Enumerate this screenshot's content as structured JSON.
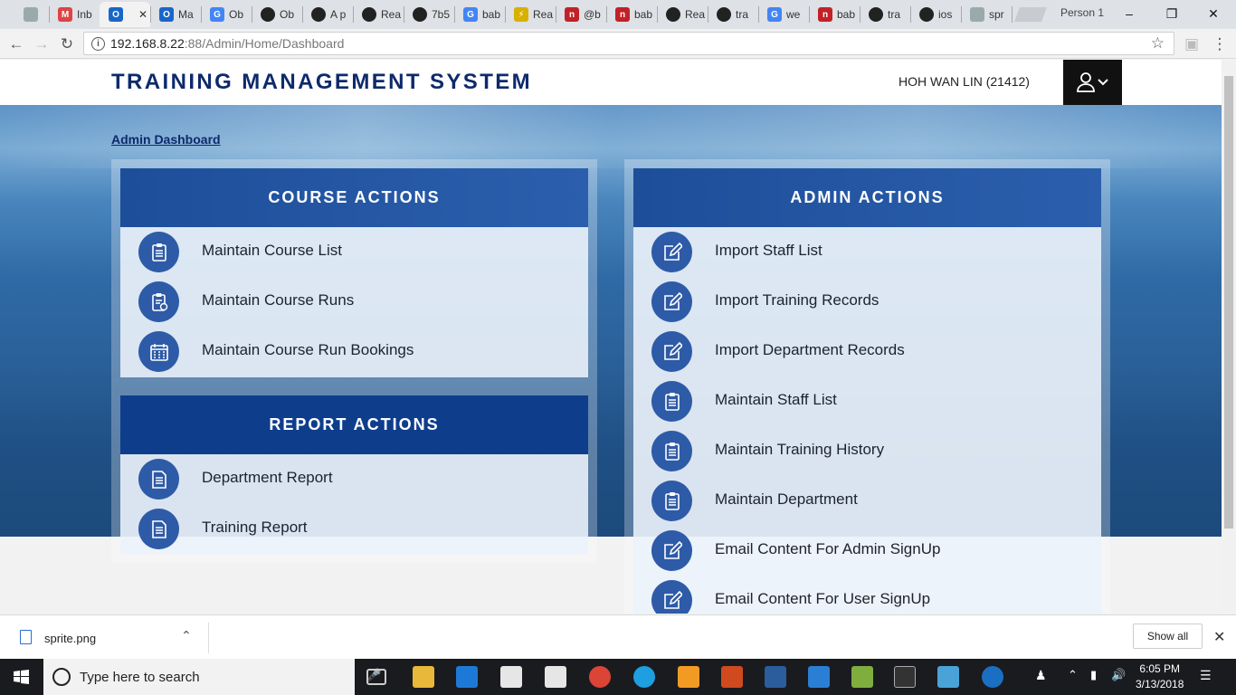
{
  "browser": {
    "tabs": [
      {
        "label": "",
        "icon": "page-icon"
      },
      {
        "label": "Inb",
        "icon": "gmail-icon"
      },
      {
        "label": "",
        "icon": "app-icon"
      },
      {
        "label": "Ma",
        "icon": "app-icon"
      },
      {
        "label": "Ob",
        "icon": "google-icon"
      },
      {
        "label": "Ob",
        "icon": "github-icon"
      },
      {
        "label": "A p",
        "icon": "github-icon"
      },
      {
        "label": "Rea",
        "icon": "github-icon"
      },
      {
        "label": "7b5",
        "icon": "github-icon"
      },
      {
        "label": "bab",
        "icon": "google-icon"
      },
      {
        "label": "Rea",
        "icon": "bolt-icon"
      },
      {
        "label": "@b",
        "icon": "npm-icon"
      },
      {
        "label": "bab",
        "icon": "npm-icon"
      },
      {
        "label": "Rea",
        "icon": "github-icon"
      },
      {
        "label": "tra",
        "icon": "github-icon"
      },
      {
        "label": "we",
        "icon": "google-icon"
      },
      {
        "label": "bab",
        "icon": "npm-icon"
      },
      {
        "label": "tra",
        "icon": "github-icon"
      },
      {
        "label": "ios",
        "icon": "github-icon"
      },
      {
        "label": "spr",
        "icon": "page-icon"
      }
    ],
    "profile": "Person 1",
    "url_host": "192.168.8.22",
    "url_path": ":88/Admin/Home/Dashboard"
  },
  "app": {
    "title": "TRAINING MANAGEMENT SYSTEM",
    "user": "HOH WAN LIN (21412)",
    "breadcrumb": "Admin Dashboard"
  },
  "panels": {
    "course": {
      "title": "COURSE ACTIONS",
      "items": [
        {
          "label": "Maintain Course List",
          "icon": "clipboard-icon"
        },
        {
          "label": "Maintain Course Runs",
          "icon": "clipboard-check-icon"
        },
        {
          "label": "Maintain Course Run Bookings",
          "icon": "calendar-icon"
        }
      ]
    },
    "report": {
      "title": "REPORT ACTIONS",
      "items": [
        {
          "label": "Department Report",
          "icon": "document-icon"
        },
        {
          "label": "Training Report",
          "icon": "document-icon"
        }
      ]
    },
    "admin": {
      "title": "ADMIN ACTIONS",
      "items": [
        {
          "label": "Import Staff List",
          "icon": "edit-icon"
        },
        {
          "label": "Import Training Records",
          "icon": "edit-icon"
        },
        {
          "label": "Import Department Records",
          "icon": "edit-icon"
        },
        {
          "label": "Maintain Staff List",
          "icon": "clipboard-icon"
        },
        {
          "label": "Maintain Training History",
          "icon": "clipboard-icon"
        },
        {
          "label": "Maintain Department",
          "icon": "clipboard-icon"
        },
        {
          "label": "Email Content For Admin SignUp",
          "icon": "edit-icon"
        },
        {
          "label": "Email Content For User SignUp",
          "icon": "edit-icon"
        }
      ]
    }
  },
  "downloads": {
    "file": "sprite.png",
    "show_all": "Show all"
  },
  "taskbar": {
    "search_placeholder": "Type here to search",
    "time": "6:05 PM",
    "date": "3/13/2018"
  },
  "colors": {
    "brand": "#0d2a6b",
    "panel_header": "#1d4e9a",
    "icon_circle": "#2e5ba7"
  }
}
